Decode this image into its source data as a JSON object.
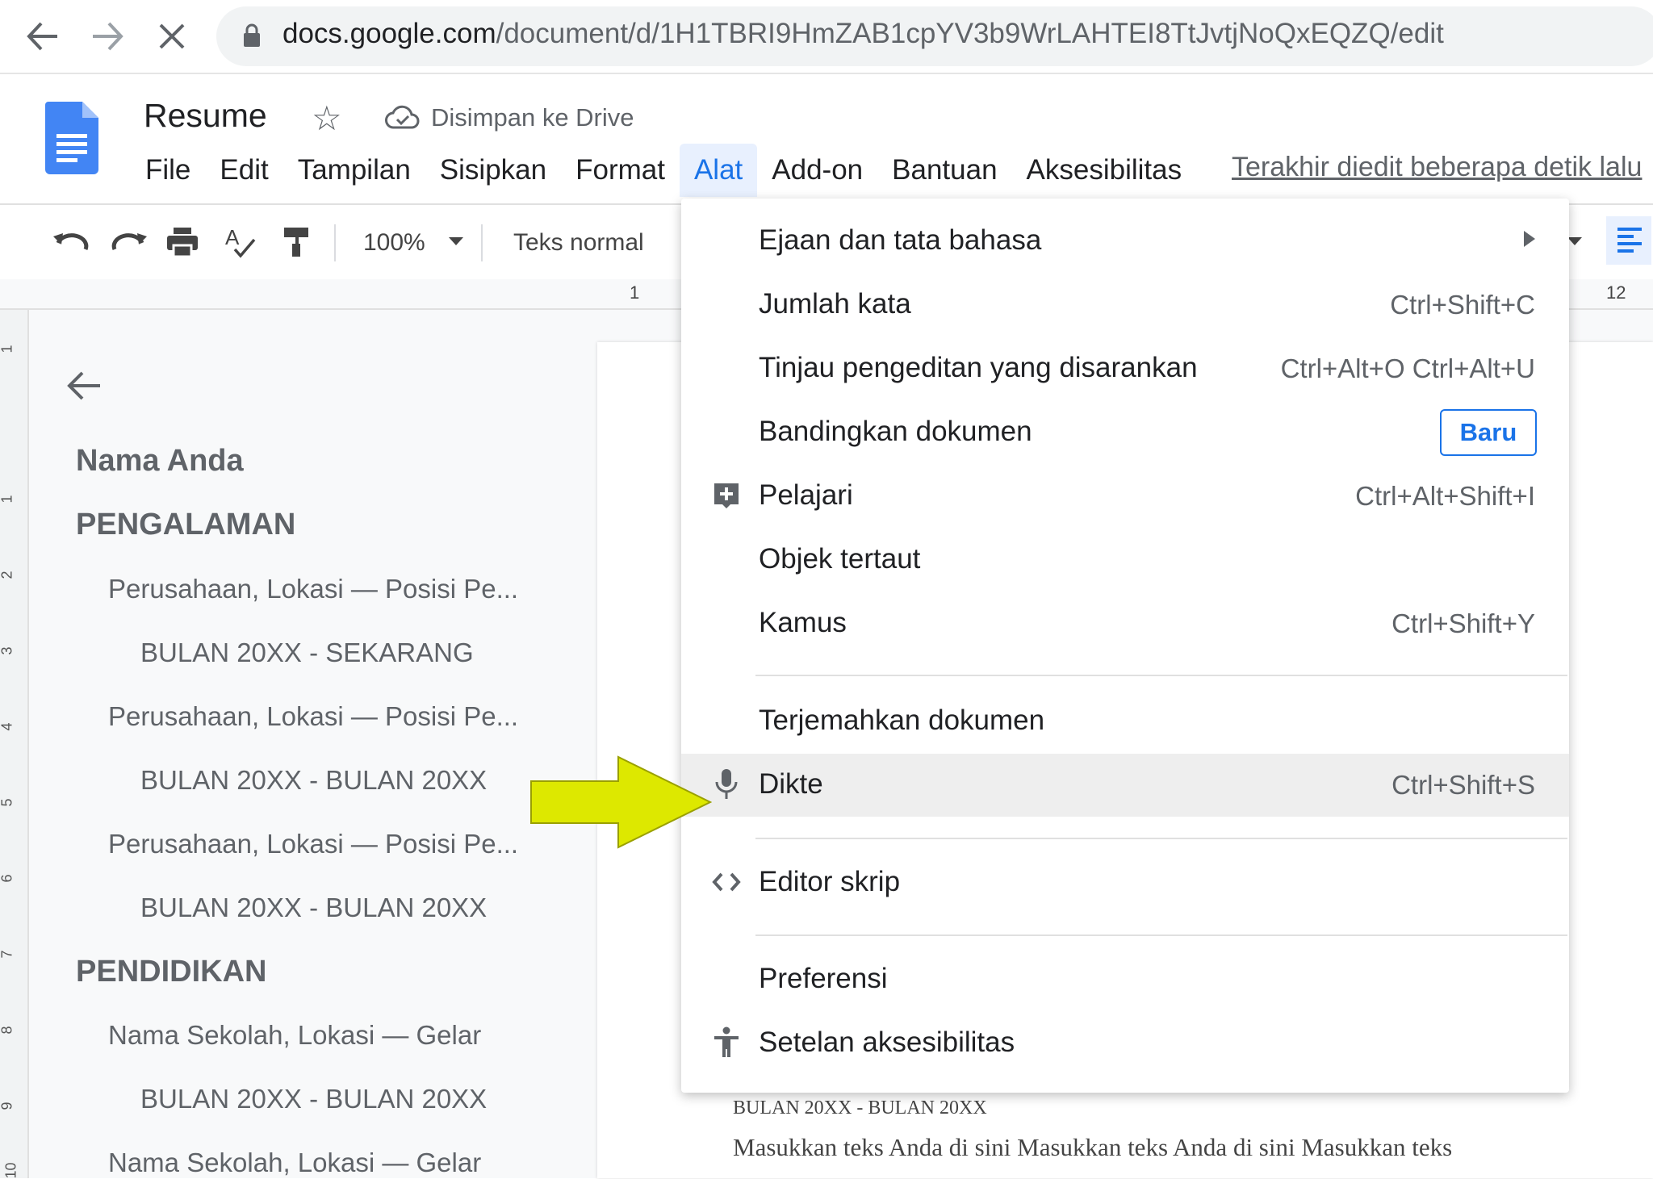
{
  "browser": {
    "url_host": "docs.google.com",
    "url_path": "/document/d/1H1TBRI9HmZAB1cpYV3b9WrLAHTEI8TtJvtjNoQxEQZQ/edit",
    "back_icon": "back-arrow-icon",
    "forward_icon": "forward-arrow-icon",
    "stop_icon": "close-icon"
  },
  "header": {
    "title": "Resume",
    "saved_status": "Disimpan ke Drive",
    "last_edit": "Terakhir diedit beberapa detik lalu"
  },
  "menu": {
    "items": [
      "File",
      "Edit",
      "Tampilan",
      "Sisipkan",
      "Format",
      "Alat",
      "Add-on",
      "Bantuan",
      "Aksesibilitas"
    ],
    "active": "Alat"
  },
  "toolbar": {
    "zoom": "100%",
    "style": "Teks normal"
  },
  "ruler": {
    "left_mark": "1",
    "right_mark": "12"
  },
  "vertical_ruler": [
    "1",
    "1",
    "2",
    "3",
    "4",
    "5",
    "6",
    "7",
    "8",
    "9",
    "10"
  ],
  "outline": {
    "items": [
      {
        "text": "Nama Anda",
        "level": "h1"
      },
      {
        "text": "PENGALAMAN",
        "level": "h1"
      },
      {
        "text": "Perusahaan, Lokasi — Posisi Pe...",
        "level": "h2"
      },
      {
        "text": "BULAN 20XX - SEKARANG",
        "level": "h3"
      },
      {
        "text": "Perusahaan, Lokasi — Posisi Pe...",
        "level": "h2"
      },
      {
        "text": "BULAN 20XX - BULAN 20XX",
        "level": "h3"
      },
      {
        "text": "Perusahaan, Lokasi — Posisi Pe...",
        "level": "h2"
      },
      {
        "text": "BULAN 20XX - BULAN 20XX",
        "level": "h3"
      },
      {
        "text": "PENDIDIKAN",
        "level": "h1"
      },
      {
        "text": "Nama Sekolah, Lokasi — Gelar",
        "level": "h2"
      },
      {
        "text": "BULAN 20XX - BULAN 20XX",
        "level": "h3"
      },
      {
        "text": "Nama Sekolah, Lokasi — Gelar",
        "level": "h2"
      }
    ]
  },
  "dropdown": {
    "items": [
      {
        "label": "Ejaan dan tata bahasa",
        "shortcut": "",
        "submenu": true
      },
      {
        "label": "Jumlah kata",
        "shortcut": "Ctrl+Shift+C"
      },
      {
        "label": "Tinjau pengeditan yang disarankan",
        "shortcut": "Ctrl+Alt+O Ctrl+Alt+U"
      },
      {
        "label": "Bandingkan dokumen",
        "badge": "Baru"
      },
      {
        "label": "Pelajari",
        "shortcut": "Ctrl+Alt+Shift+I",
        "icon": "explore-plus-icon"
      },
      {
        "label": "Objek tertaut",
        "shortcut": ""
      },
      {
        "label": "Kamus",
        "shortcut": "Ctrl+Shift+Y"
      },
      {
        "label": "Terjemahkan dokumen",
        "shortcut": ""
      },
      {
        "label": "Dikte",
        "shortcut": "Ctrl+Shift+S",
        "icon": "microphone-icon",
        "highlighted": true
      },
      {
        "label": "Editor skrip",
        "shortcut": "",
        "icon": "code-icon"
      },
      {
        "label": "Preferensi",
        "shortcut": ""
      },
      {
        "label": "Setelan aksesibilitas",
        "shortcut": "",
        "icon": "accessibility-icon"
      }
    ]
  },
  "document": {
    "date_line": "BULAN 20XX - BULAN 20XX",
    "body_line": "Masukkan teks Anda di sini Masukkan teks Anda di sini Masukkan teks"
  },
  "colors": {
    "accent": "#1a73e8",
    "annotation_arrow": "#dde800",
    "docs_blue": "#4285f4"
  }
}
